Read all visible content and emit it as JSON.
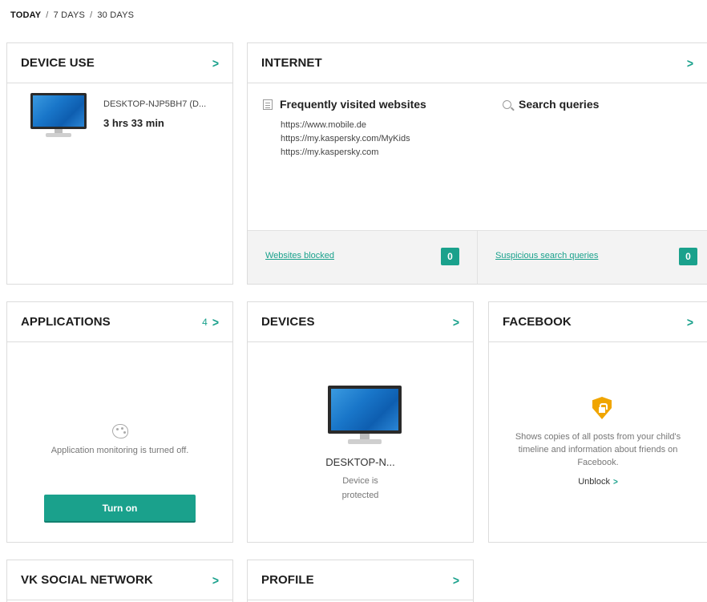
{
  "period": {
    "options": [
      "TODAY",
      "7 DAYS",
      "30 DAYS"
    ],
    "separator": "/"
  },
  "device_use": {
    "title": "DEVICE USE",
    "device_name": "DESKTOP-NJP5BH7 (D...",
    "usage_time": "3 hrs 33 min"
  },
  "internet": {
    "title": "INTERNET",
    "frequent_title": "Frequently visited websites",
    "sites": [
      "https://www.mobile.de",
      "https://my.kaspersky.com/MyKids",
      "https://my.kaspersky.com"
    ],
    "search_title": "Search queries",
    "websites_blocked_label": "Websites blocked",
    "websites_blocked_count": "0",
    "suspicious_label": "Suspicious search queries",
    "suspicious_count": "0"
  },
  "applications": {
    "title": "APPLICATIONS",
    "count": "4",
    "status_text": "Application monitoring is turned off.",
    "button_label": "Turn on"
  },
  "devices": {
    "title": "DEVICES",
    "device_name": "DESKTOP-N...",
    "status_line1": "Device is",
    "status_line2": "protected"
  },
  "facebook": {
    "title": "FACEBOOK",
    "description": "Shows copies of all posts from your child's timeline and information about friends on Facebook.",
    "unblock_label": "Unblock"
  },
  "vk": {
    "title": "VK SOCIAL NETWORK"
  },
  "profile": {
    "title": "PROFILE"
  },
  "colors": {
    "accent": "#1aa18c",
    "shield": "#f0a500",
    "border": "#dcdcdc"
  }
}
